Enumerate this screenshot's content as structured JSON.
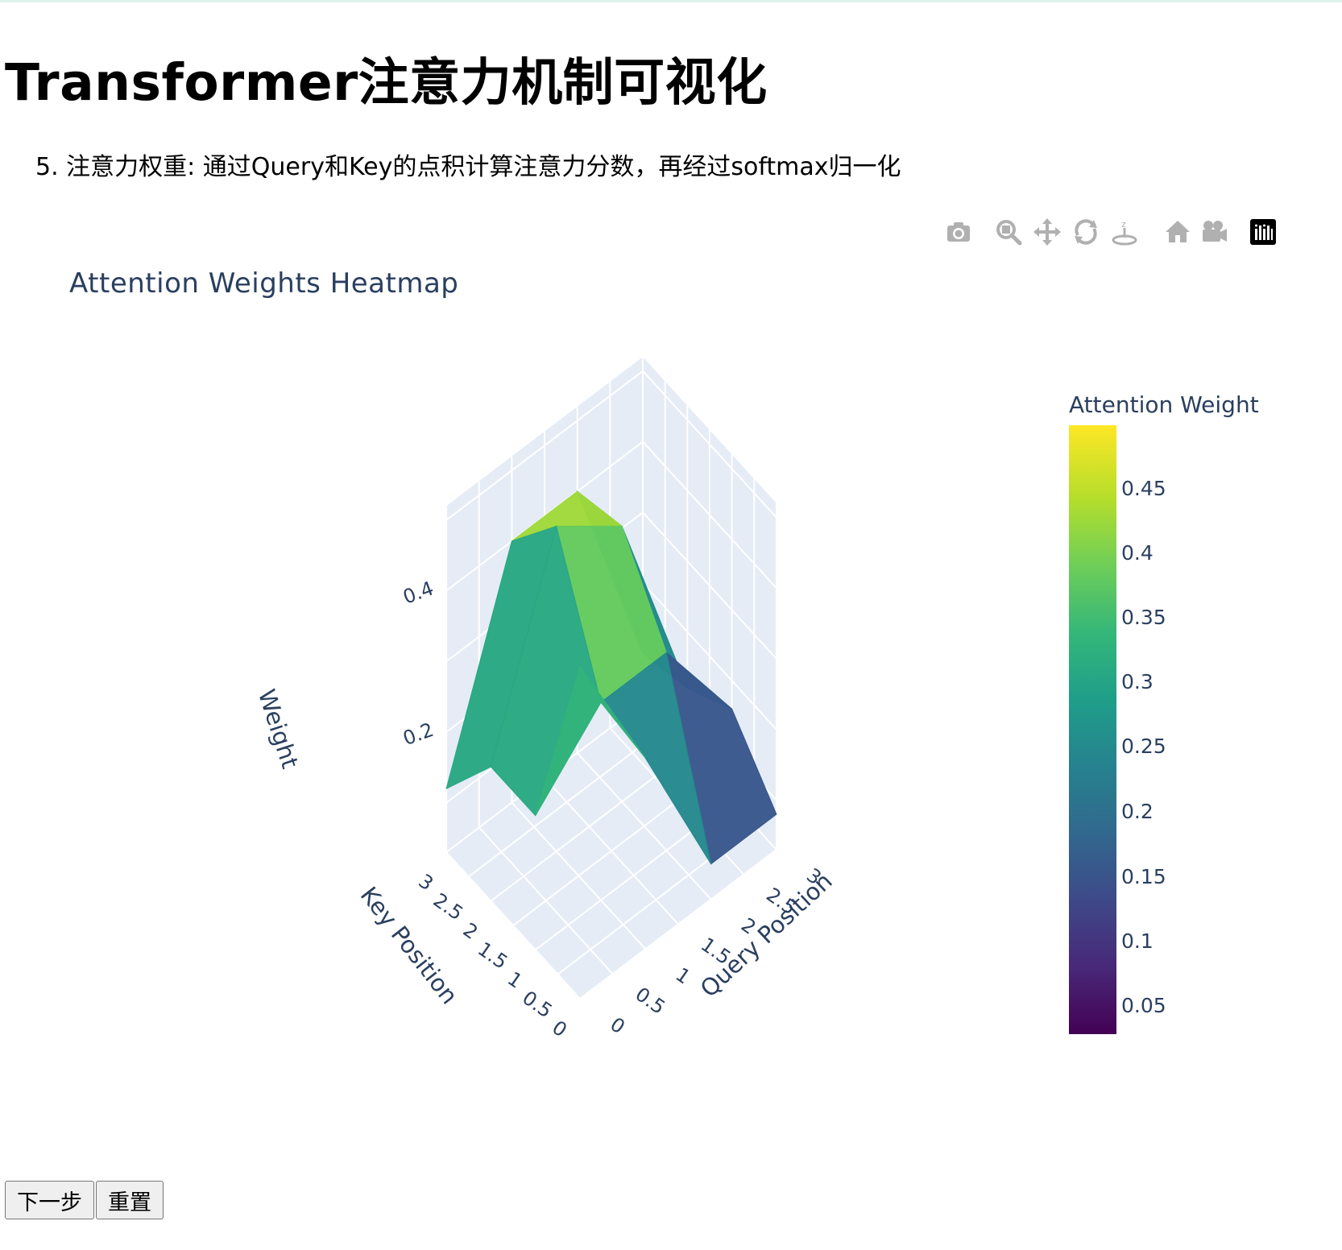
{
  "page": {
    "title": "Transformer注意力机制可视化",
    "step_description": "5. 注意力权重: 通过Query和Key的点积计算注意力分数，再经过softmax归一化"
  },
  "modebar": {
    "icons": [
      "camera-icon",
      "zoom-icon",
      "pan-icon",
      "orbit-rotation-icon",
      "turntable-rotation-icon",
      "home-icon",
      "save-camera-icon",
      "plotly-logo-icon"
    ]
  },
  "chart_data": {
    "type": "surface",
    "title": "Attention Weights Heatmap",
    "x_axis": {
      "label": "Key Position",
      "ticks": [
        "0",
        "0.5",
        "1",
        "1.5",
        "2",
        "2.5",
        "3"
      ],
      "range": [
        0,
        3
      ]
    },
    "y_axis": {
      "label": "Query Position",
      "ticks": [
        "0",
        "0.5",
        "1",
        "1.5",
        "2",
        "2.5",
        "3"
      ],
      "range": [
        0,
        3
      ]
    },
    "z_axis": {
      "label": "Weight",
      "ticks": [
        "0.2",
        "0.4"
      ]
    },
    "colorscale": "Viridis",
    "colorbar": {
      "title": "Attention Weight",
      "ticks": [
        "0.45",
        "0.4",
        "0.35",
        "0.3",
        "0.25",
        "0.2",
        "0.15",
        "0.1",
        "0.05"
      ]
    },
    "z": [
      [
        0.5,
        0.3,
        0.08,
        0.08
      ],
      [
        0.22,
        0.31,
        0.31,
        0.16
      ],
      [
        0.22,
        0.49,
        0.42,
        0.12
      ],
      [
        0.12,
        0.4,
        0.4,
        0.1
      ]
    ]
  },
  "buttons": {
    "next_label": "下一步",
    "reset_label": "重置"
  }
}
